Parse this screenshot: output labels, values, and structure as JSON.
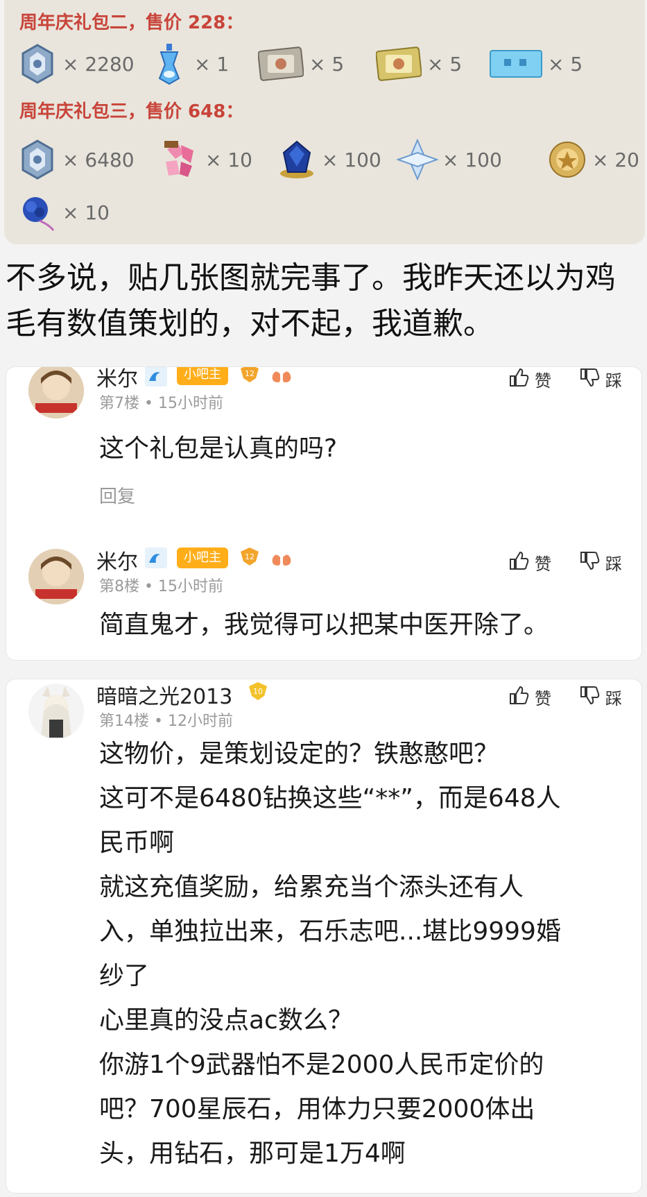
{
  "gift_image": {
    "pack2": {
      "title": "周年庆礼包二，售价 228：",
      "items": [
        {
          "icon": "crystal-icon",
          "qty": "× 2280"
        },
        {
          "icon": "potion-icon",
          "qty": "× 1"
        },
        {
          "icon": "ticket-card-icon",
          "qty": "× 5"
        },
        {
          "icon": "gold-ticket-icon",
          "qty": "× 5"
        },
        {
          "icon": "blue-ticket-icon",
          "qty": "× 5"
        }
      ]
    },
    "pack3": {
      "title": "周年庆礼包三，售价 648：",
      "items": [
        {
          "icon": "crystal-icon",
          "qty": "× 6480"
        },
        {
          "icon": "fragment-icon",
          "qty": "× 10"
        },
        {
          "icon": "blue-gem-icon",
          "qty": "× 100"
        },
        {
          "icon": "star-diamond-icon",
          "qty": "× 100"
        },
        {
          "icon": "gold-medal-icon",
          "qty": "× 20"
        },
        {
          "icon": "blue-rose-icon",
          "qty": "× 10"
        }
      ]
    }
  },
  "post": {
    "text": "不多说，贴几张图就完事了。我昨天还以为鸡毛有数值策划的，对不起，我道歉。"
  },
  "comments": [
    {
      "user": "米尔",
      "badge": "小吧主",
      "level": "12",
      "meta": "第7楼 • 15小时前",
      "body": "这个礼包是认真的吗?",
      "reply": "回复",
      "like": "赞",
      "dislike": "踩"
    },
    {
      "user": "米尔",
      "badge": "小吧主",
      "level": "12",
      "meta": "第8楼 • 15小时前",
      "body": "简直鬼才，我觉得可以把某中医开除了。",
      "like": "赞",
      "dislike": "踩"
    },
    {
      "user": "暗暗之光2013",
      "level": "10",
      "meta": "第14楼 • 12小时前",
      "body_lines": [
        "这物价，是策划设定的？铁憨憨吧？",
        "这可不是6480钻换这些“**”，而是648人",
        "民币啊",
        "就这充值奖励，给累充当个添头还有人",
        "入，单独拉出来，石乐志吧...堪比9999婚",
        "纱了",
        "心里真的没点ac数么？",
        "你游1个9武器怕不是2000人民币定价的",
        "吧？700星辰石，用体力只要2000体出",
        "头，用钻石，那可是1万4啊"
      ],
      "like": "赞",
      "dislike": "踩"
    }
  ],
  "colors": {
    "accent_red": "#c8443a",
    "badge_orange": "#ffae1a",
    "muted_gray": "#9a9a9a"
  }
}
